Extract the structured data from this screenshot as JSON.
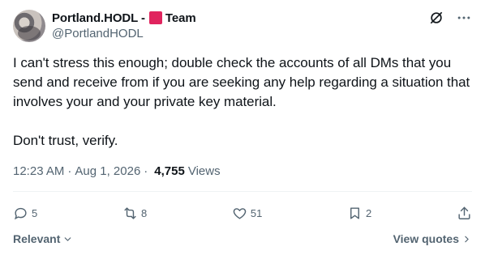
{
  "author": {
    "display_name_prefix": "Portland.HODL -",
    "display_name_suffix": "Team",
    "handle": "@PortlandHODL",
    "emoji_square_color": "#e0245e"
  },
  "tweet": {
    "paragraph1": "I can't stress this enough; double check the accounts of all DMs that you send and receive from if you are seeking any help regarding a situation that involves your and your private key material.",
    "paragraph2": "Don't trust, verify."
  },
  "meta": {
    "time": "12:23 AM",
    "date": "Aug 1, 2026",
    "views_count": "4,755",
    "views_label": "Views",
    "separator": "·"
  },
  "actions": {
    "replies": "5",
    "reposts": "8",
    "likes": "51",
    "bookmarks": "2"
  },
  "footer": {
    "sort_label": "Relevant",
    "view_quotes_label": "View quotes"
  },
  "icons": {
    "grok": "grok-icon",
    "more": "more-icon",
    "reply": "reply-icon",
    "repost": "repost-icon",
    "like": "heart-icon",
    "bookmark": "bookmark-icon",
    "share": "share-icon"
  },
  "colors": {
    "text_primary": "#0f1419",
    "text_secondary": "#536471",
    "divider": "#eff3f4"
  }
}
